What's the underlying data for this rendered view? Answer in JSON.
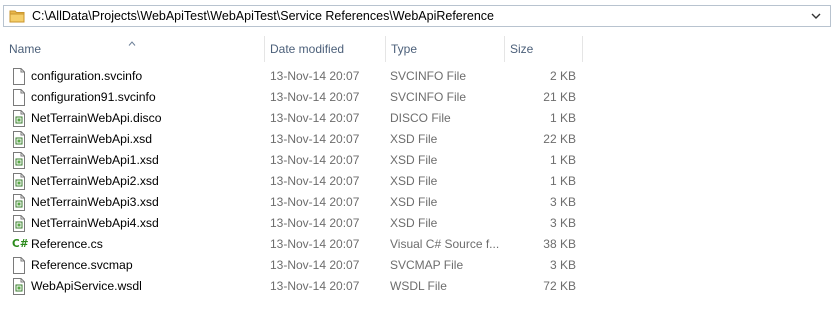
{
  "address_bar": {
    "path": "C:\\AllData\\Projects\\WebApiTest\\WebApiTest\\Service References\\WebApiReference",
    "folder_icon": "folder-icon",
    "dropdown_icon": "chevron-down-icon"
  },
  "columns": {
    "name": "Name",
    "date_modified": "Date modified",
    "type": "Type",
    "size": "Size",
    "sort_indicator": "sort-ascending-icon"
  },
  "files": [
    {
      "name": "configuration.svcinfo",
      "date": "13-Nov-14 20:07",
      "type": "SVCINFO File",
      "size": "2 KB",
      "icon": "generic-file-icon"
    },
    {
      "name": "configuration91.svcinfo",
      "date": "13-Nov-14 20:07",
      "type": "SVCINFO File",
      "size": "21 KB",
      "icon": "generic-file-icon"
    },
    {
      "name": "NetTerrainWebApi.disco",
      "date": "13-Nov-14 20:07",
      "type": "DISCO File",
      "size": "1 KB",
      "icon": "xml-file-icon"
    },
    {
      "name": "NetTerrainWebApi.xsd",
      "date": "13-Nov-14 20:07",
      "type": "XSD File",
      "size": "22 KB",
      "icon": "xml-file-icon"
    },
    {
      "name": "NetTerrainWebApi1.xsd",
      "date": "13-Nov-14 20:07",
      "type": "XSD File",
      "size": "1 KB",
      "icon": "xml-file-icon"
    },
    {
      "name": "NetTerrainWebApi2.xsd",
      "date": "13-Nov-14 20:07",
      "type": "XSD File",
      "size": "1 KB",
      "icon": "xml-file-icon"
    },
    {
      "name": "NetTerrainWebApi3.xsd",
      "date": "13-Nov-14 20:07",
      "type": "XSD File",
      "size": "3 KB",
      "icon": "xml-file-icon"
    },
    {
      "name": "NetTerrainWebApi4.xsd",
      "date": "13-Nov-14 20:07",
      "type": "XSD File",
      "size": "3 KB",
      "icon": "xml-file-icon"
    },
    {
      "name": "Reference.cs",
      "date": "13-Nov-14 20:07",
      "type": "Visual C# Source f...",
      "size": "38 KB",
      "icon": "csharp-file-icon"
    },
    {
      "name": "Reference.svcmap",
      "date": "13-Nov-14 20:07",
      "type": "SVCMAP File",
      "size": "3 KB",
      "icon": "generic-file-icon"
    },
    {
      "name": "WebApiService.wsdl",
      "date": "13-Nov-14 20:07",
      "type": "WSDL File",
      "size": "72 KB",
      "icon": "xml-file-icon"
    }
  ],
  "colors": {
    "header_text": "#4c607a",
    "detail_text": "#6d6d6d",
    "address_border": "#b8c3cf",
    "folder_yellow": "#e8b64a",
    "csharp_green": "#2a8a1a"
  }
}
